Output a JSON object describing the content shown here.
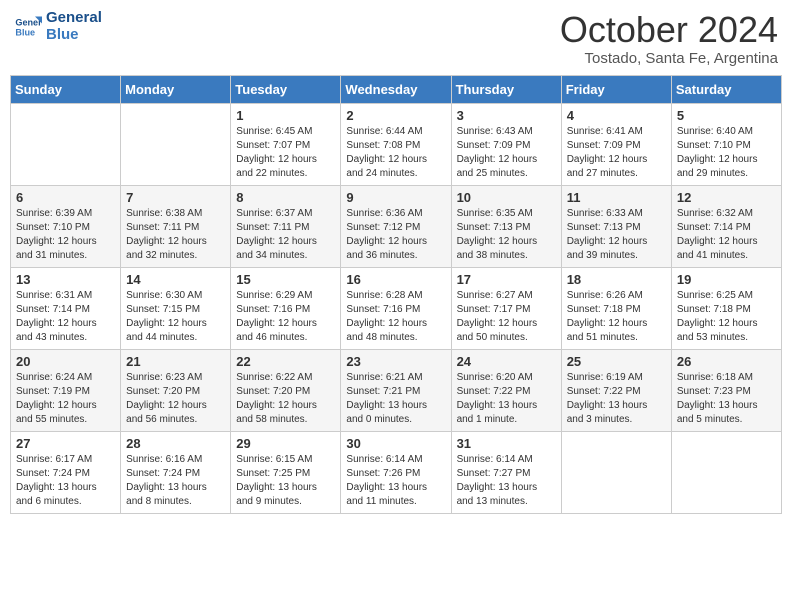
{
  "logo": {
    "line1": "General",
    "line2": "Blue"
  },
  "title": "October 2024",
  "subtitle": "Tostado, Santa Fe, Argentina",
  "days_of_week": [
    "Sunday",
    "Monday",
    "Tuesday",
    "Wednesday",
    "Thursday",
    "Friday",
    "Saturday"
  ],
  "weeks": [
    [
      {
        "day": "",
        "info": ""
      },
      {
        "day": "",
        "info": ""
      },
      {
        "day": "1",
        "info": "Sunrise: 6:45 AM\nSunset: 7:07 PM\nDaylight: 12 hours and 22 minutes."
      },
      {
        "day": "2",
        "info": "Sunrise: 6:44 AM\nSunset: 7:08 PM\nDaylight: 12 hours and 24 minutes."
      },
      {
        "day": "3",
        "info": "Sunrise: 6:43 AM\nSunset: 7:09 PM\nDaylight: 12 hours and 25 minutes."
      },
      {
        "day": "4",
        "info": "Sunrise: 6:41 AM\nSunset: 7:09 PM\nDaylight: 12 hours and 27 minutes."
      },
      {
        "day": "5",
        "info": "Sunrise: 6:40 AM\nSunset: 7:10 PM\nDaylight: 12 hours and 29 minutes."
      }
    ],
    [
      {
        "day": "6",
        "info": "Sunrise: 6:39 AM\nSunset: 7:10 PM\nDaylight: 12 hours and 31 minutes."
      },
      {
        "day": "7",
        "info": "Sunrise: 6:38 AM\nSunset: 7:11 PM\nDaylight: 12 hours and 32 minutes."
      },
      {
        "day": "8",
        "info": "Sunrise: 6:37 AM\nSunset: 7:11 PM\nDaylight: 12 hours and 34 minutes."
      },
      {
        "day": "9",
        "info": "Sunrise: 6:36 AM\nSunset: 7:12 PM\nDaylight: 12 hours and 36 minutes."
      },
      {
        "day": "10",
        "info": "Sunrise: 6:35 AM\nSunset: 7:13 PM\nDaylight: 12 hours and 38 minutes."
      },
      {
        "day": "11",
        "info": "Sunrise: 6:33 AM\nSunset: 7:13 PM\nDaylight: 12 hours and 39 minutes."
      },
      {
        "day": "12",
        "info": "Sunrise: 6:32 AM\nSunset: 7:14 PM\nDaylight: 12 hours and 41 minutes."
      }
    ],
    [
      {
        "day": "13",
        "info": "Sunrise: 6:31 AM\nSunset: 7:14 PM\nDaylight: 12 hours and 43 minutes."
      },
      {
        "day": "14",
        "info": "Sunrise: 6:30 AM\nSunset: 7:15 PM\nDaylight: 12 hours and 44 minutes."
      },
      {
        "day": "15",
        "info": "Sunrise: 6:29 AM\nSunset: 7:16 PM\nDaylight: 12 hours and 46 minutes."
      },
      {
        "day": "16",
        "info": "Sunrise: 6:28 AM\nSunset: 7:16 PM\nDaylight: 12 hours and 48 minutes."
      },
      {
        "day": "17",
        "info": "Sunrise: 6:27 AM\nSunset: 7:17 PM\nDaylight: 12 hours and 50 minutes."
      },
      {
        "day": "18",
        "info": "Sunrise: 6:26 AM\nSunset: 7:18 PM\nDaylight: 12 hours and 51 minutes."
      },
      {
        "day": "19",
        "info": "Sunrise: 6:25 AM\nSunset: 7:18 PM\nDaylight: 12 hours and 53 minutes."
      }
    ],
    [
      {
        "day": "20",
        "info": "Sunrise: 6:24 AM\nSunset: 7:19 PM\nDaylight: 12 hours and 55 minutes."
      },
      {
        "day": "21",
        "info": "Sunrise: 6:23 AM\nSunset: 7:20 PM\nDaylight: 12 hours and 56 minutes."
      },
      {
        "day": "22",
        "info": "Sunrise: 6:22 AM\nSunset: 7:20 PM\nDaylight: 12 hours and 58 minutes."
      },
      {
        "day": "23",
        "info": "Sunrise: 6:21 AM\nSunset: 7:21 PM\nDaylight: 13 hours and 0 minutes."
      },
      {
        "day": "24",
        "info": "Sunrise: 6:20 AM\nSunset: 7:22 PM\nDaylight: 13 hours and 1 minute."
      },
      {
        "day": "25",
        "info": "Sunrise: 6:19 AM\nSunset: 7:22 PM\nDaylight: 13 hours and 3 minutes."
      },
      {
        "day": "26",
        "info": "Sunrise: 6:18 AM\nSunset: 7:23 PM\nDaylight: 13 hours and 5 minutes."
      }
    ],
    [
      {
        "day": "27",
        "info": "Sunrise: 6:17 AM\nSunset: 7:24 PM\nDaylight: 13 hours and 6 minutes."
      },
      {
        "day": "28",
        "info": "Sunrise: 6:16 AM\nSunset: 7:24 PM\nDaylight: 13 hours and 8 minutes."
      },
      {
        "day": "29",
        "info": "Sunrise: 6:15 AM\nSunset: 7:25 PM\nDaylight: 13 hours and 9 minutes."
      },
      {
        "day": "30",
        "info": "Sunrise: 6:14 AM\nSunset: 7:26 PM\nDaylight: 13 hours and 11 minutes."
      },
      {
        "day": "31",
        "info": "Sunrise: 6:14 AM\nSunset: 7:27 PM\nDaylight: 13 hours and 13 minutes."
      },
      {
        "day": "",
        "info": ""
      },
      {
        "day": "",
        "info": ""
      }
    ]
  ]
}
